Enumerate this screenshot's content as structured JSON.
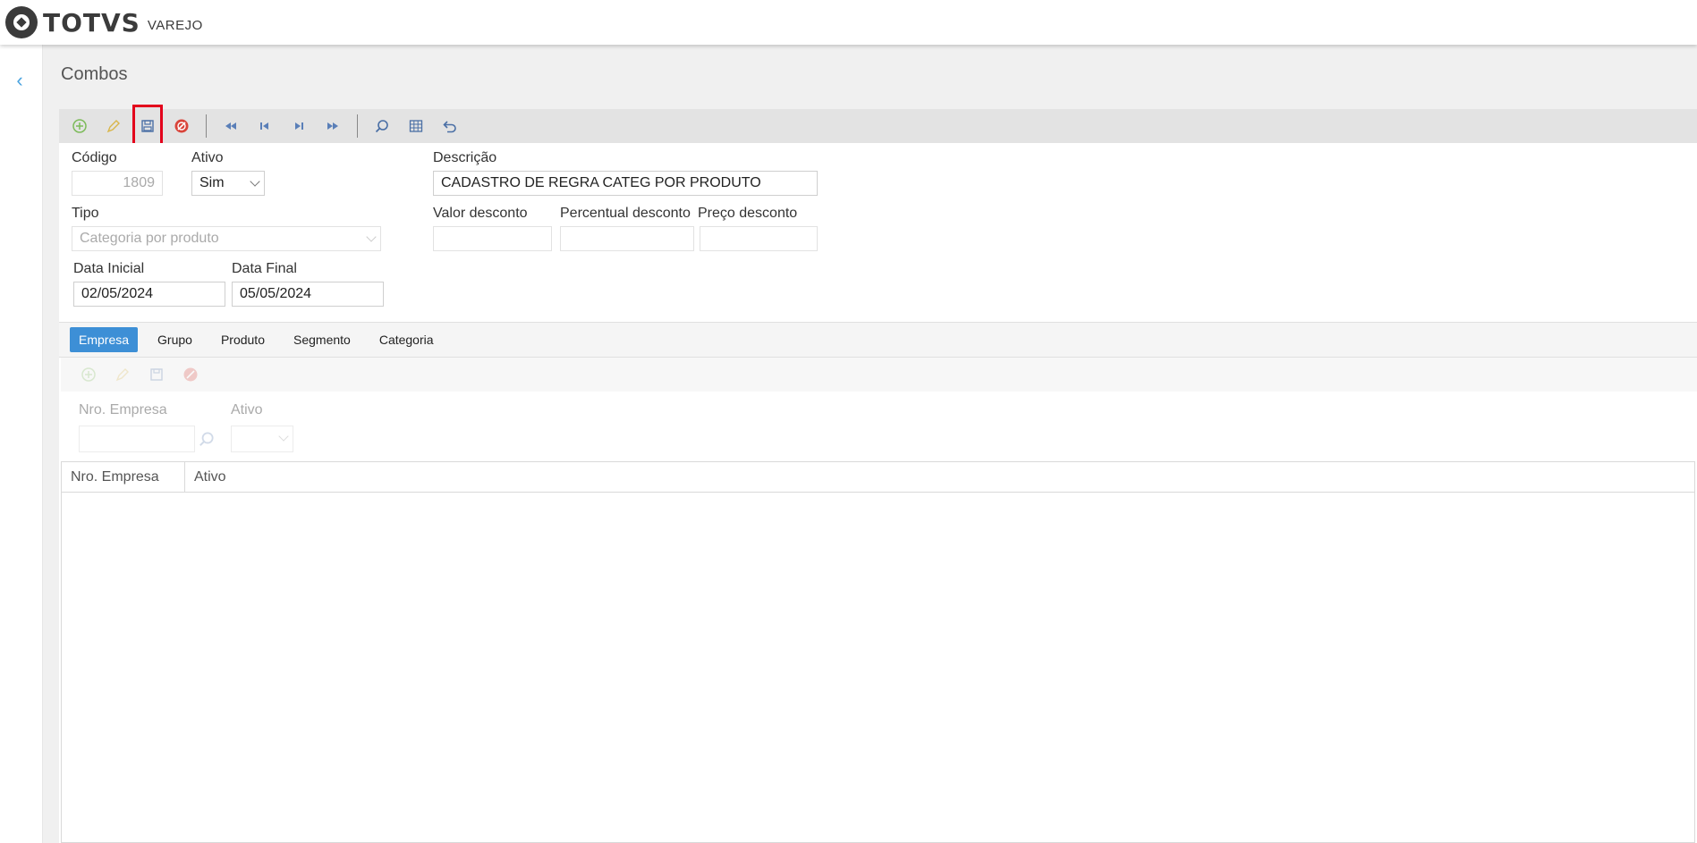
{
  "header": {
    "brand": "TOTVS",
    "brand_sub": "VAREJO"
  },
  "page": {
    "title": "Combos"
  },
  "form": {
    "codigo_label": "Código",
    "codigo_value": "1809",
    "ativo_label": "Ativo",
    "ativo_value": "Sim",
    "descricao_label": "Descrição",
    "descricao_value": "CADASTRO DE REGRA CATEG POR PRODUTO",
    "tipo_label": "Tipo",
    "tipo_value": "Categoria por produto",
    "valor_desconto_label": "Valor desconto",
    "percentual_desconto_label": "Percentual desconto",
    "preco_desconto_label": "Preço desconto",
    "data_inicial_label": "Data Inicial",
    "data_inicial_value": "02/05/2024",
    "data_final_label": "Data Final",
    "data_final_value": "05/05/2024"
  },
  "tabs": [
    {
      "label": "Empresa",
      "active": true
    },
    {
      "label": "Grupo"
    },
    {
      "label": "Produto"
    },
    {
      "label": "Segmento"
    },
    {
      "label": "Categoria"
    }
  ],
  "subform": {
    "nro_empresa_label": "Nro. Empresa",
    "ativo_label": "Ativo"
  },
  "grid": {
    "columns": [
      "Nro. Empresa",
      "Ativo"
    ]
  },
  "colors": {
    "accent": "#3d8fd6",
    "highlight": "#e3001b",
    "toolbar": "#e3e3e3"
  }
}
